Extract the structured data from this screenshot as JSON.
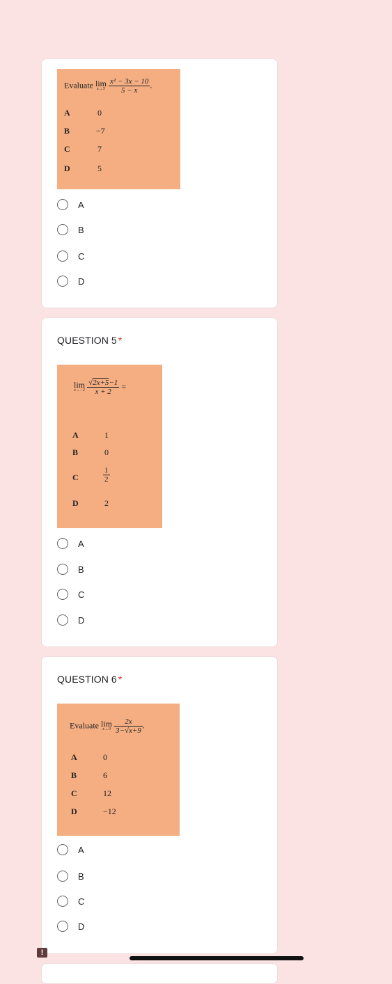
{
  "q4": {
    "math": {
      "prompt_word": "Evaluate",
      "lim_word": "lim",
      "lim_sub": "x→5",
      "numerator": "x² − 3x − 10",
      "denominator": "5 − x",
      "trail": ".",
      "choices": [
        {
          "letter": "A",
          "value": "0"
        },
        {
          "letter": "B",
          "value": "−7"
        },
        {
          "letter": "C",
          "value": "7"
        },
        {
          "letter": "D",
          "value": "5"
        }
      ]
    },
    "options": [
      "A",
      "B",
      "C",
      "D"
    ]
  },
  "q5": {
    "title": "QUESTION 5",
    "required_mark": "*",
    "math": {
      "lim_word": "lim",
      "lim_sub": "x→−2",
      "num_root": "2x+5",
      "num_rest": "−1",
      "denominator": "x + 2",
      "trail": "=",
      "choices": [
        {
          "letter": "A",
          "value": "1"
        },
        {
          "letter": "B",
          "value": "0"
        },
        {
          "letter": "C",
          "num": "1",
          "den": "2"
        },
        {
          "letter": "D",
          "value": "2"
        }
      ]
    },
    "options": [
      "A",
      "B",
      "C",
      "D"
    ]
  },
  "q6": {
    "title": "QUESTION 6",
    "required_mark": "*",
    "math": {
      "prompt_word": "Evaluate",
      "lim_word": "lim",
      "lim_sub": "x→0",
      "numerator": "2x",
      "den_pre": "3−",
      "den_root": "x+9",
      "trail": ".",
      "choices": [
        {
          "letter": "A",
          "value": "0"
        },
        {
          "letter": "B",
          "value": "6"
        },
        {
          "letter": "C",
          "value": "12"
        },
        {
          "letter": "D",
          "value": "−12"
        }
      ]
    },
    "options": [
      "A",
      "B",
      "C",
      "D"
    ]
  },
  "footer": {
    "report_icon": "!"
  }
}
